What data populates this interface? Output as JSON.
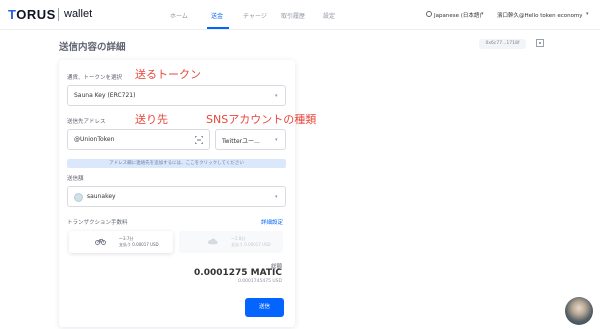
{
  "app": {
    "logo": "TORUS",
    "logo_sub": "wallet"
  },
  "nav": {
    "items": [
      {
        "label": "ホーム"
      },
      {
        "label": "送金"
      },
      {
        "label": "チャージ"
      },
      {
        "label": "取引履歴"
      },
      {
        "label": "設定"
      }
    ],
    "active_index": 1
  },
  "header": {
    "language": "Japanese (日本語)",
    "user": "濱口幹久@Hello token economy"
  },
  "page": {
    "title": "送信内容の詳細",
    "address": "0x6c77...1718f"
  },
  "form": {
    "token_label": "通貨、トークンを選択",
    "token_value": "Sauna Key (ERC721)",
    "recipient_label": "送信先アドレス",
    "recipient_value": "@UnionToken",
    "account_type_value": "Twitterユー...",
    "hint": "アドレス欄に連絡先を追加するには、ここをクリックしてください",
    "amount_label": "送信額",
    "nft_value": "saunakey",
    "fee_label": "トランザクション手数料",
    "fee_details": "詳細設定",
    "fee_options": [
      {
        "time": "～3.7分",
        "cost": "支払う 0.00017 USD",
        "selected": true
      },
      {
        "time": "～2.8分",
        "cost": "支払う 0.00017 USD",
        "selected": false
      }
    ],
    "total_label": "総額",
    "total_value": "0.0001275 MATIC",
    "total_usd": "0.0001745475 USD",
    "send_button": "送信"
  },
  "annotations": {
    "token": "送るトークン",
    "recipient": "送り先",
    "account_type": "SNSアカウントの種類"
  },
  "colors": {
    "accent": "#0364ff",
    "annotation": "#e8463c",
    "hint_bg": "#dbe8fb"
  }
}
